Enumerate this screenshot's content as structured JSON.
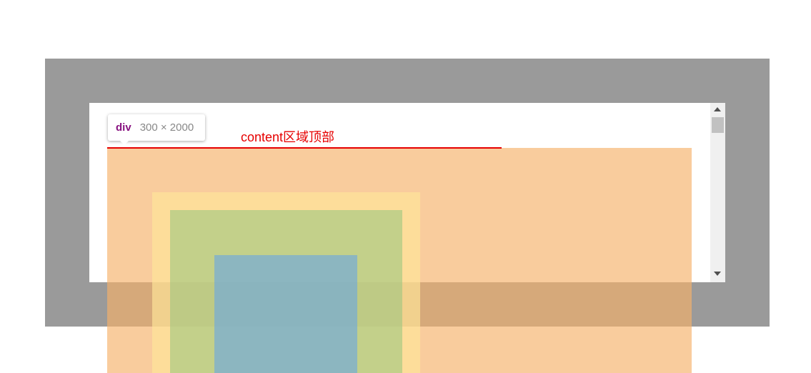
{
  "annotation": {
    "label": "content区域顶部"
  },
  "tooltip": {
    "tag": "div",
    "dimensions": "300 × 2000"
  },
  "colors": {
    "frame": "#9a9a9a",
    "viewport": "#ffffff",
    "margin_highlight": "#f6b26b",
    "border_highlight": "#ffe599",
    "padding_highlight": "#93c47d",
    "content_highlight": "#6fa8dc",
    "annotation": "#e60000",
    "tooltip_tag": "#881280"
  },
  "icons": {
    "scroll_up": "triangle-up-icon",
    "scroll_down": "triangle-down-icon"
  }
}
